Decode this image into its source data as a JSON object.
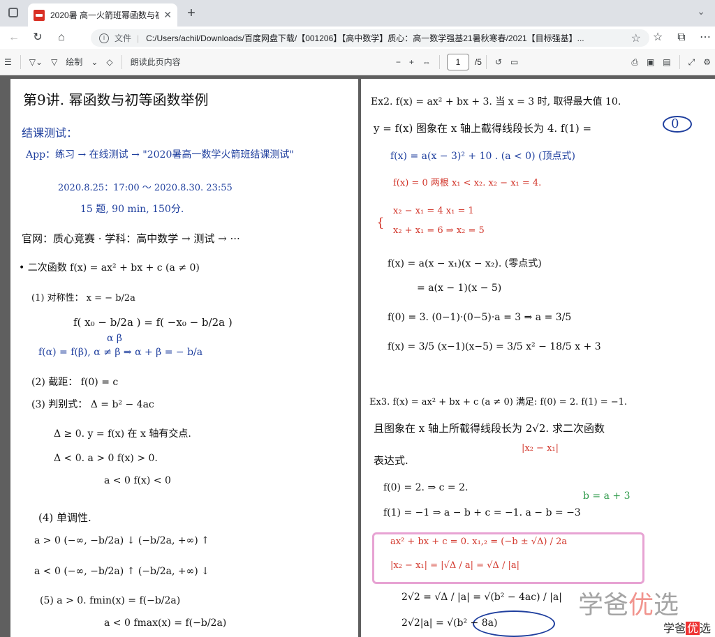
{
  "browser": {
    "tab_title": "2020暑 高一火箭班幂函数与初等",
    "close": "✕",
    "new_tab": "+",
    "tab_menu": "⌄",
    "scheme": "文件",
    "url": "C:/Users/achil/Downloads/百度网盘下载/【001206】【高中数学】质心：高一数学强基21暑秋寒春/2021【目标强基】...",
    "star": "☆"
  },
  "toolbar": {
    "draw_label": "绘制",
    "read_aloud": "朗读此页内容",
    "zoom_out": "−",
    "zoom_in": "+",
    "page_current": "1",
    "page_total": "/5"
  },
  "page_left": {
    "lines": [
      "第9讲. 幂函数与初等函数举例",
      "结课测试：",
      "App：练习 → 在线测试 → \"2020暑高一数学火箭班结课测试\"",
      "2020.8.25：17:00 ～ 2020.8.30. 23:55",
      "15 题, 90 min, 150分.",
      "官网：质心竞赛 · 学科：高中数学 → 测试 → ···",
      "• 二次函数    f(x) = ax² + bx + c   (a ≠ 0)",
      "(1) 对称性：    x = − b/2a",
      "f( x₀ − b/2a ) = f( −x₀ − b/2a )",
      "α                          β",
      "f(α) = f(β), α ≠ β  ⇒  α + β = − b/a",
      "(2) 截距：      f(0) = c",
      "(3) 判别式：  Δ = b² − 4ac",
      "Δ ≥ 0.  y = f(x) 在 x 轴有交点.",
      "Δ < 0.     a > 0     f(x) > 0.",
      "a < 0     f(x) < 0",
      "(4)  单调性.",
      "a > 0   (−∞, −b/2a) ↓      (−b/2a, +∞) ↑",
      "a < 0   (−∞, −b/2a) ↑      (−b/2a, +∞) ↓",
      "(5)    a > 0.     fmin(x) = f(−b/2a)",
      "a < 0     fmax(x) = f(−b/2a)"
    ]
  },
  "page_right": {
    "lines": [
      "Ex2.  f(x) = ax² + bx + 3.  当 x = 3 时, 取得最大值 10.",
      "y = f(x) 图象在 x 轴上截得线段长为 4.   f(1) =",
      "0",
      "f(x) = a(x − 3)² + 10 .  (a < 0)  (顶点式)",
      "f(x) = 0  两根  x₁ < x₂.        x₂ − x₁ = 4.",
      "x₂ − x₁ = 4              x₁ = 1",
      "x₂ + x₁ = 6      ⇒      x₂ = 5",
      "f(x) = a(x − x₁)(x − x₂).   (零点式)",
      "= a(x − 1)(x − 5)",
      "f(0) = 3.      (0−1)·(0−5)·a = 3  ⇒   a = 3/5",
      "f(x) = 3/5 (x−1)(x−5) = 3/5 x² − 18/5 x + 3",
      "Ex3.  f(x) = ax² + bx + c  (a ≠ 0) 满足: f(0) = 2.  f(1) = −1.",
      "且图象在 x 轴上所截得线段长为 2√2. 求二次函数",
      "|x₂ − x₁|",
      "表达式.",
      "f(0) = 2.   ⇒  c = 2.",
      "b = a + 3",
      "f(1) = −1   ⇒   a − b + c = −1.       a − b = −3",
      "ax² + bx + c = 0.        x₁,₂ = (−b ± √Δ) / 2a",
      "|x₂ − x₁| = |√Δ / a| = √Δ / |a|",
      "2√2 =  √Δ / |a| = √(b² − 4ac) / |a|",
      "2√2|a| = √(b² − 8a)"
    ]
  },
  "watermark": {
    "big_pre": "学爸",
    "big_mid": "优",
    "big_post": "选",
    "small_pre": "学爸",
    "small_mid": "优",
    "small_post": "选"
  }
}
